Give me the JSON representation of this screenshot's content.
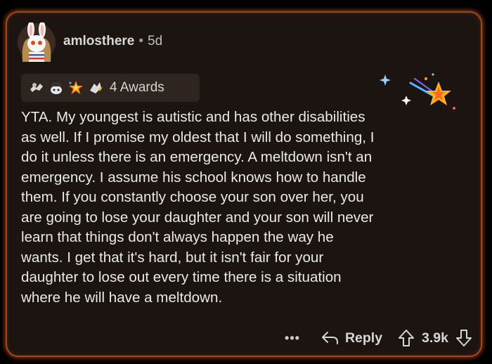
{
  "comment": {
    "username": "amlosthere",
    "separator": "•",
    "age": "5d",
    "awards_label": "4 Awards",
    "award_icons": [
      "wholesome-seal-icon",
      "ally-icon",
      "starstruck-icon",
      "take-my-energy-icon"
    ],
    "text": "YTA. My youngest is autistic and has other disabilities\nas well. If I promise my oldest that I will do something, I\ndo it unless there is an emergency. A meltdown isn't an\nemergency. I assume his school knows how to handle\nthem. If you constantly choose your son over her, you\nare going to lose your daughter and your son will never\nlearn that things don't always happen the way he\nwants. I get that it's hard, but it isn't fair for your\ndaughter to lose out every time there is a situation\nwhere he will have a meltdown."
  },
  "actions": {
    "more": "•••",
    "reply_label": "Reply",
    "score": "3.9k"
  },
  "colors": {
    "border_glow": "#a4451f",
    "card_bg": "#1b1411",
    "award_bg": "#2e2420"
  }
}
